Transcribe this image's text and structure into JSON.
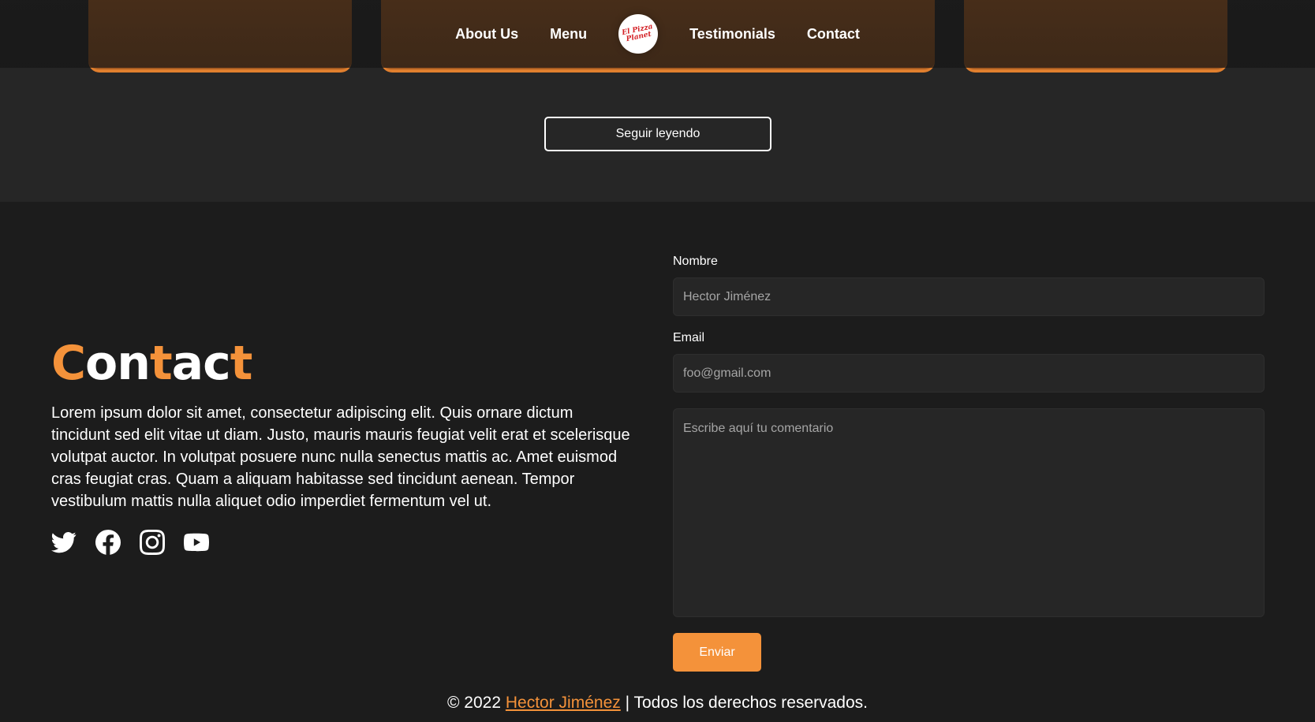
{
  "nav": {
    "items": [
      {
        "label": "About Us"
      },
      {
        "label": "Menu"
      },
      {
        "label": "Testimonials"
      },
      {
        "label": "Contact"
      }
    ],
    "logo_text": "El Pizza Planet"
  },
  "testimonials": {
    "read_more_label": "Seguir leyendo"
  },
  "contact": {
    "title_parts": [
      "C",
      "on",
      "t",
      "ac",
      "t"
    ],
    "text": "Lorem ipsum dolor sit amet, consectetur adipiscing elit. Quis ornare dictum tincidunt sed elit vitae ut diam. Justo, mauris mauris feugiat velit erat et scelerisque volutpat auctor. In volutpat posuere nunc nulla senectus mattis ac. Amet euismod cras feugiat cras. Quam a aliquam habitasse sed tincidunt aenean. Tempor vestibulum mattis nulla aliquet odio imperdiet fermentum vel ut.",
    "socials": [
      "twitter-icon",
      "facebook-icon",
      "instagram-icon",
      "youtube-icon"
    ]
  },
  "form": {
    "name_label": "Nombre",
    "name_placeholder": "Hector Jiménez",
    "email_label": "Email",
    "email_placeholder": "foo@gmail.com",
    "comment_placeholder": "Escribe aquí tu comentario",
    "submit_label": "Enviar"
  },
  "footer": {
    "prefix": "© 2022",
    "author": "Hector Jiménez",
    "suffix": "| Todos los derechos reservados."
  },
  "colors": {
    "accent": "#f4923a",
    "background": "#1c1c1c",
    "band": "#262626",
    "card": "#a85d22"
  }
}
